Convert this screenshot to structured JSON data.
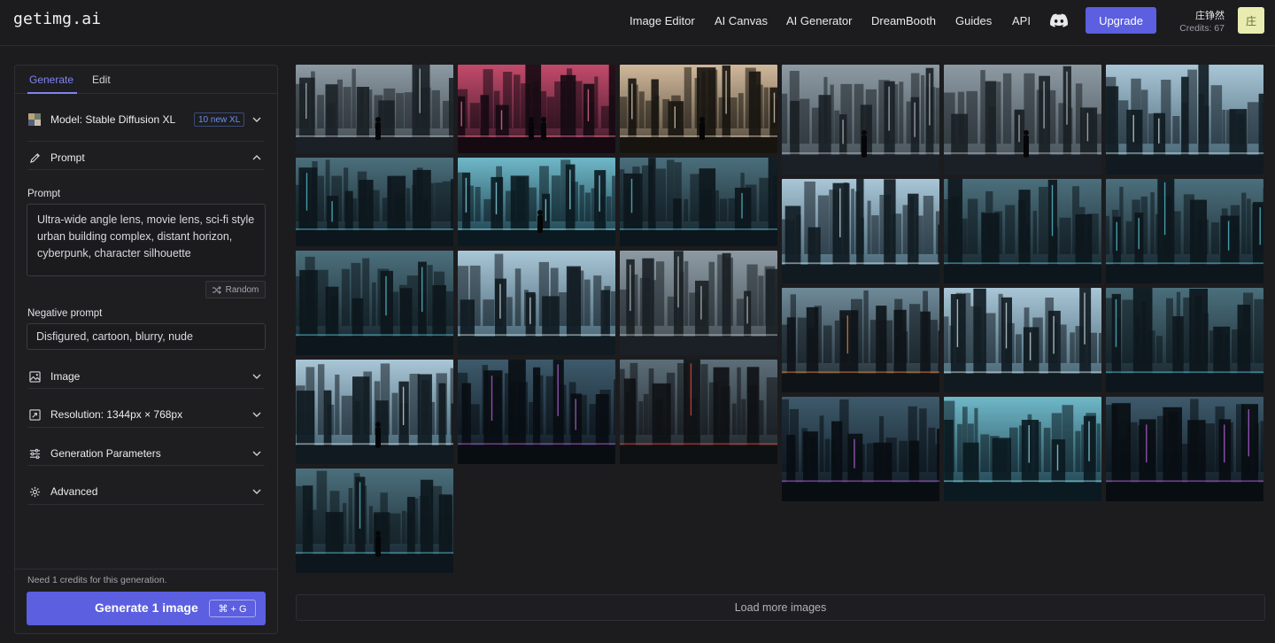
{
  "header": {
    "logo": "getimg.ai",
    "nav": [
      {
        "label": "Image Editor",
        "name": "nav-image-editor"
      },
      {
        "label": "AI Canvas",
        "name": "nav-ai-canvas"
      },
      {
        "label": "AI Generator",
        "name": "nav-ai-generator"
      },
      {
        "label": "DreamBooth",
        "name": "nav-dreambooth"
      },
      {
        "label": "Guides",
        "name": "nav-guides"
      },
      {
        "label": "API",
        "name": "nav-api"
      }
    ],
    "discord_icon": "discord-icon",
    "upgrade_label": "Upgrade",
    "user_name": "庄铮然",
    "credits": "Credits: 67",
    "avatar_letter": "庄"
  },
  "sidebar": {
    "tabs": [
      {
        "label": "Generate",
        "active": true
      },
      {
        "label": "Edit",
        "active": false
      }
    ],
    "model": {
      "label": "Model: Stable Diffusion XL",
      "badge": "10 new XL"
    },
    "prompt_section": {
      "label": "Prompt",
      "expanded": true
    },
    "prompt_field": {
      "label": "Prompt",
      "value": "Ultra-wide angle lens, movie lens, sci-fi style urban building complex, distant horizon, cyberpunk, character silhouette"
    },
    "random_label": "Random",
    "negative_prompt": {
      "label": "Negative prompt",
      "value": "Disfigured, cartoon, blurry, nude"
    },
    "sections": [
      {
        "label": "Image",
        "icon": "image-icon"
      },
      {
        "label": "Resolution: 1344px × 768px",
        "icon": "resize-icon"
      },
      {
        "label": "Generation Parameters",
        "icon": "sliders-icon"
      },
      {
        "label": "Advanced",
        "icon": "gear-icon"
      }
    ],
    "need_credits": "Need 1 credits for this generation.",
    "generate": {
      "label": "Generate 1 image",
      "shortcut": "⌘ + G"
    }
  },
  "gallery": {
    "images": [
      {
        "col": 0,
        "theme": "haze",
        "figures": 1
      },
      {
        "col": 0,
        "theme": "teal",
        "figures": 0
      },
      {
        "col": 0,
        "theme": "teal",
        "figures": 0
      },
      {
        "col": 0,
        "theme": "sky",
        "figures": 1
      },
      {
        "col": 0,
        "theme": "teal",
        "figures": 1
      },
      {
        "col": 1,
        "theme": "pink",
        "figures": 2
      },
      {
        "col": 1,
        "theme": "cyan",
        "figures": 1
      },
      {
        "col": 1,
        "theme": "sky",
        "figures": 0
      },
      {
        "col": 1,
        "theme": "neon",
        "figures": 0
      },
      {
        "col": 2,
        "theme": "warm",
        "figures": 1
      },
      {
        "col": 2,
        "theme": "teal",
        "figures": 0
      },
      {
        "col": 2,
        "theme": "haze",
        "figures": 0
      },
      {
        "col": 2,
        "theme": "red",
        "figures": 0
      },
      {
        "col": 3,
        "theme": "haze",
        "figures": 1
      },
      {
        "col": 3,
        "theme": "sky",
        "figures": 0
      },
      {
        "col": 3,
        "theme": "orange",
        "figures": 0
      },
      {
        "col": 3,
        "theme": "neon",
        "figures": 0
      },
      {
        "col": 4,
        "theme": "haze",
        "figures": 1
      },
      {
        "col": 4,
        "theme": "teal",
        "figures": 0
      },
      {
        "col": 4,
        "theme": "sky",
        "figures": 0
      },
      {
        "col": 4,
        "theme": "cyan",
        "figures": 0
      },
      {
        "col": 5,
        "theme": "sky",
        "figures": 0
      },
      {
        "col": 5,
        "theme": "teal",
        "figures": 0
      },
      {
        "col": 5,
        "theme": "teal",
        "figures": 0
      },
      {
        "col": 5,
        "theme": "neon",
        "figures": 0
      }
    ],
    "load_more_label": "Load more images"
  },
  "colors": {
    "accent": "#5b5fe0",
    "tab_active": "#7f85f2",
    "background": "#1c1c1f"
  }
}
